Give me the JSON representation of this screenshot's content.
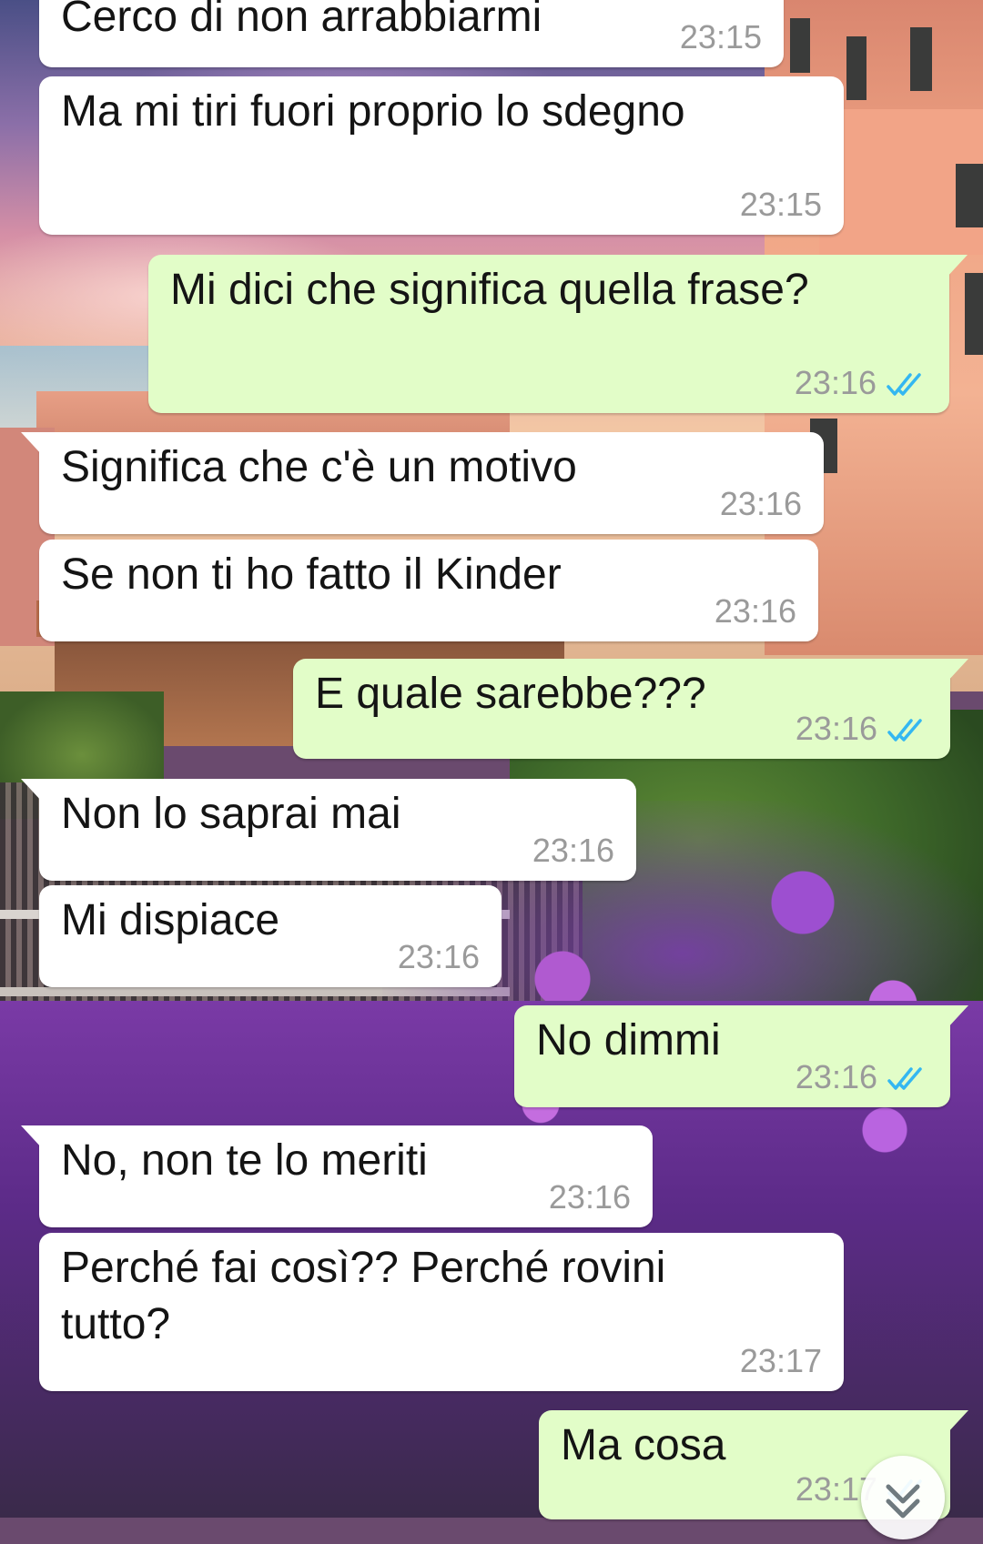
{
  "messages": [
    {
      "direction": "in",
      "text": "Cerco di non arrabbiarmi",
      "time": "23:15"
    },
    {
      "direction": "in",
      "text": "Ma mi tiri fuori proprio lo sdegno",
      "time": "23:15"
    },
    {
      "direction": "out",
      "text": "Mi dici che significa quella frase?",
      "time": "23:16",
      "status": "read"
    },
    {
      "direction": "in",
      "text": "Significa che c'è un motivo",
      "time": "23:16"
    },
    {
      "direction": "in",
      "text": "Se non ti ho fatto il Kinder",
      "time": "23:16"
    },
    {
      "direction": "out",
      "text": "E quale sarebbe???",
      "time": "23:16",
      "status": "read"
    },
    {
      "direction": "in",
      "text": "Non lo saprai mai",
      "time": "23:16"
    },
    {
      "direction": "in",
      "text": "Mi dispiace",
      "time": "23:16"
    },
    {
      "direction": "out",
      "text": "No dimmi",
      "time": "23:16",
      "status": "read"
    },
    {
      "direction": "in",
      "text": "No, non te lo meriti",
      "time": "23:16"
    },
    {
      "direction": "in",
      "text": "Perché fai così?? Perché rovini\ntutto?",
      "time": "23:17"
    },
    {
      "direction": "out",
      "text": "Ma cosa",
      "time": "23:17",
      "status": "read"
    }
  ],
  "colors": {
    "incoming_bubble": "#ffffff",
    "outgoing_bubble": "#e2fdc8",
    "read_ticks": "#34b7f1",
    "timestamp": "#9a9a9a"
  },
  "icons": {
    "read_receipt": "double-check-icon",
    "scroll_down": "chevron-double-down-icon"
  }
}
